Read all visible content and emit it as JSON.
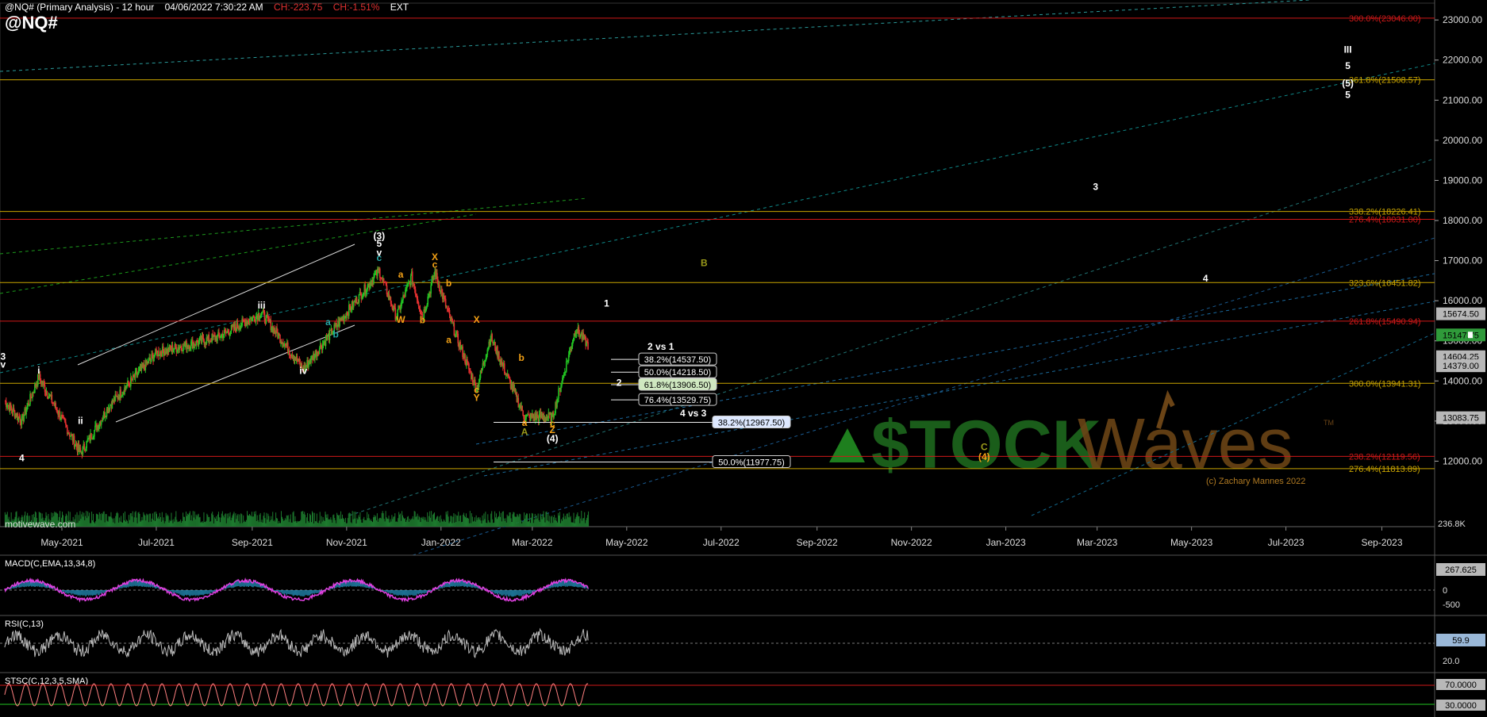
{
  "header": {
    "title": "@NQ# (Primary Analysis) - 12 hour",
    "datetime": "04/06/2022 7:30:22 AM",
    "change_abs": "CH:-223.75",
    "change_pct": "CH:-1.51%",
    "session": "EXT",
    "symbol": "@NQ#"
  },
  "watermark": "motivewave.com",
  "copyright": "(c) Zachary Mannes 2022",
  "brand": {
    "left": "$TOCK",
    "right": "Waves",
    "tm": "TM"
  },
  "colors": {
    "background": "#000000",
    "red_line": "#d01818",
    "yellow_line": "#c9a400",
    "up": "#22c322",
    "down": "#e23030",
    "orange": "#f2a015",
    "white": "#ffffff"
  },
  "chart_data": {
    "type": "candlestick",
    "ylim": [
      11000,
      23300
    ],
    "y_ticks": [
      "23000.00",
      "22000.00",
      "21000.00",
      "20000.00",
      "19000.00",
      "18000.00",
      "17000.00",
      "16000.00",
      "15000.00",
      "14000.00",
      "13000.00",
      "12000.00"
    ],
    "x_labels": [
      "May-2021",
      "Jul-2021",
      "Sep-2021",
      "Nov-2021",
      "Jan-2022",
      "Mar-2022",
      "May-2022",
      "Jul-2022",
      "Sep-2022",
      "Nov-2022",
      "Jan-2023",
      "Mar-2023",
      "May-2023",
      "Jul-2023",
      "Sep-2023"
    ],
    "price_path": [
      [
        "2021-03-25",
        13500
      ],
      [
        "2021-04-05",
        13000
      ],
      [
        "2021-04-16",
        14100
      ],
      [
        "2021-05-13",
        12200
      ],
      [
        "2021-06-01",
        13400
      ],
      [
        "2021-07-01",
        14700
      ],
      [
        "2021-08-10",
        15100
      ],
      [
        "2021-09-07",
        15700
      ],
      [
        "2021-10-04",
        14300
      ],
      [
        "2021-11-22",
        16750
      ],
      [
        "2021-12-03",
        15600
      ],
      [
        "2021-12-13",
        16600
      ],
      [
        "2021-12-20",
        15600
      ],
      [
        "2021-12-28",
        16700
      ],
      [
        "2022-01-10",
        15200
      ],
      [
        "2022-01-24",
        13800
      ],
      [
        "2022-02-02",
        15100
      ],
      [
        "2022-02-24",
        13100
      ],
      [
        "2022-03-14",
        13100
      ],
      [
        "2022-03-29",
        15300
      ],
      [
        "2022-04-06",
        14900
      ]
    ],
    "last_price": 15147.75,
    "fib_levels": [
      {
        "label": "300.0%(23046.00)",
        "value": 23046.0,
        "color": "red"
      },
      {
        "label": "361.8%(21508.57)",
        "value": 21508.57,
        "color": "yellow"
      },
      {
        "label": "338.2%(18226.41)",
        "value": 18226.41,
        "color": "yellow"
      },
      {
        "label": "276.4%(18031.00)",
        "value": 18031.0,
        "color": "red"
      },
      {
        "label": "323.6%(16451.82)",
        "value": 16451.82,
        "color": "yellow"
      },
      {
        "label": "261.8%(15490.94)",
        "value": 15490.94,
        "color": "red"
      },
      {
        "label": "300.0%(13941.31)",
        "value": 13941.31,
        "color": "yellow"
      },
      {
        "label": "238.2%(12119.56)",
        "value": 12119.56,
        "color": "red"
      },
      {
        "label": "276.4%(11813.89)",
        "value": 11813.89,
        "color": "yellow"
      }
    ],
    "retracement_boxes": [
      {
        "label": "38.2%(14537.50)",
        "value": 14537.5
      },
      {
        "label": "50.0%(14218.50)",
        "value": 14218.5
      },
      {
        "label": "61.8%(13906.50)",
        "value": 13906.5,
        "highlight": true
      },
      {
        "label": "76.4%(13529.75)",
        "value": 13529.75
      },
      {
        "label": "38.2%(12967.50)",
        "value": 12967.5
      },
      {
        "label": "50.0%(11977.75)",
        "value": 11977.75
      }
    ],
    "right_tags": [
      {
        "label": "15674.50",
        "value": 15674.5,
        "style": "gray"
      },
      {
        "label": "15147.75",
        "value": 15147.75,
        "style": "green"
      },
      {
        "label": "14604.25",
        "value": 14604.25,
        "style": "gray"
      },
      {
        "label": "14379.00",
        "value": 14379.0,
        "style": "gray"
      },
      {
        "label": "13083.75",
        "value": 13083.75,
        "style": "gray"
      }
    ],
    "volume_label": "236.8K",
    "wave_labels": [
      {
        "text": "(3)",
        "date": "2021-11-22",
        "price": 17540,
        "color": "white"
      },
      {
        "text": "5",
        "date": "2021-11-22",
        "price": 17350,
        "color": "white"
      },
      {
        "text": "v",
        "date": "2021-11-22",
        "price": 17120,
        "color": "white"
      },
      {
        "text": "X",
        "date": "2021-12-28",
        "price": 17010,
        "color": "orange"
      },
      {
        "text": "c",
        "date": "2021-12-28",
        "price": 16820,
        "color": "orange"
      },
      {
        "text": "a",
        "date": "2021-12-06",
        "price": 16580,
        "color": "orange"
      },
      {
        "text": "b",
        "date": "2022-01-06",
        "price": 16360,
        "color": "orange"
      },
      {
        "text": "W",
        "date": "2021-12-06",
        "price": 15450,
        "color": "orange"
      },
      {
        "text": "b",
        "date": "2021-12-20",
        "price": 15440,
        "color": "orange"
      },
      {
        "text": "X",
        "date": "2022-01-24",
        "price": 15450,
        "color": "orange"
      },
      {
        "text": "a",
        "date": "2022-01-06",
        "price": 14950,
        "color": "orange"
      },
      {
        "text": "b",
        "date": "2022-02-22",
        "price": 14500,
        "color": "orange"
      },
      {
        "text": "c",
        "date": "2022-01-24",
        "price": 13700,
        "color": "orange"
      },
      {
        "text": "Y",
        "date": "2022-01-24",
        "price": 13500,
        "color": "orange"
      },
      {
        "text": "a",
        "date": "2022-02-24",
        "price": 12880,
        "color": "orange"
      },
      {
        "text": "c",
        "date": "2022-03-14",
        "price": 12860,
        "color": "orange"
      },
      {
        "text": "Z",
        "date": "2022-03-14",
        "price": 12700,
        "color": "orange"
      },
      {
        "text": "A",
        "date": "2022-02-24",
        "price": 12650,
        "color": "olive"
      },
      {
        "text": "(4)",
        "date": "2022-03-14",
        "price": 12480,
        "color": "white"
      },
      {
        "text": "1",
        "date": "2022-04-18",
        "price": 15850,
        "color": "white"
      },
      {
        "text": "2 vs 1",
        "date": "2022-05-23",
        "price": 14780,
        "color": "white"
      },
      {
        "text": "2",
        "date": "2022-04-26",
        "price": 13880,
        "color": "white"
      },
      {
        "text": "4 vs 3",
        "date": "2022-06-13",
        "price": 13120,
        "color": "white"
      },
      {
        "text": "B",
        "date": "2022-06-20",
        "price": 16860,
        "color": "olive"
      },
      {
        "text": "C",
        "date": "2022-12-18",
        "price": 12280,
        "color": "olive"
      },
      {
        "text": "(4)",
        "date": "2022-12-18",
        "price": 12030,
        "color": "orange"
      },
      {
        "text": "3",
        "date": "2023-02-28",
        "price": 18760,
        "color": "white"
      },
      {
        "text": "4",
        "date": "2023-05-10",
        "price": 16480,
        "color": "white"
      },
      {
        "text": "III",
        "date": "2023-08-10",
        "price": 22180,
        "color": "white"
      },
      {
        "text": "5",
        "date": "2023-08-10",
        "price": 21780,
        "color": "white"
      },
      {
        "text": "(5)",
        "date": "2023-08-10",
        "price": 21340,
        "color": "white"
      },
      {
        "text": "5",
        "date": "2023-08-10",
        "price": 21060,
        "color": "white"
      },
      {
        "text": "3",
        "date": "2021-03-24",
        "price": 14530,
        "color": "white"
      },
      {
        "text": "v",
        "date": "2021-03-24",
        "price": 14330,
        "color": "white"
      },
      {
        "text": "i",
        "date": "2021-04-16",
        "price": 14180,
        "color": "white"
      },
      {
        "text": "ii",
        "date": "2021-05-13",
        "price": 12930,
        "color": "white"
      },
      {
        "text": "iii",
        "date": "2021-09-07",
        "price": 15810,
        "color": "white"
      },
      {
        "text": "iv",
        "date": "2021-10-04",
        "price": 14170,
        "color": "white"
      },
      {
        "text": "4",
        "date": "2021-04-05",
        "price": 12000,
        "color": "white"
      },
      {
        "text": "a",
        "date": "2021-10-20",
        "price": 15390,
        "color": "teal"
      },
      {
        "text": "b",
        "date": "2021-10-25",
        "price": 15080,
        "color": "teal"
      },
      {
        "text": "c",
        "date": "2021-11-22",
        "price": 16990,
        "color": "teal"
      }
    ]
  },
  "indicators": {
    "macd": {
      "title": "MACD(C,EMA,13,34,8)",
      "ticks": [
        "267.625",
        "0",
        "-500"
      ]
    },
    "rsi": {
      "title": "RSI(C,13)",
      "ticks": [
        "59.9",
        "20.0"
      ]
    },
    "stoch": {
      "title": "STSC(C,12,3,5,SMA)",
      "ticks": [
        "70.0000",
        "30.0000"
      ]
    }
  }
}
